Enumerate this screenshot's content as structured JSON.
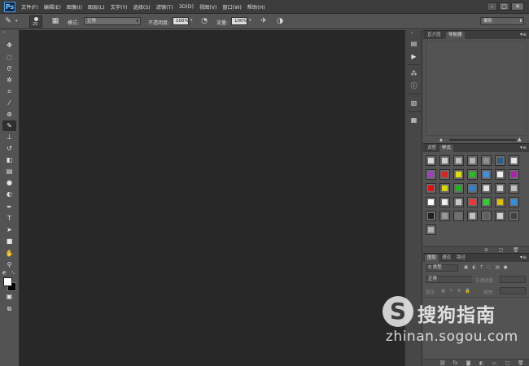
{
  "app": {
    "logo": "Ps"
  },
  "menu": [
    "文件(F)",
    "编辑(E)",
    "图像(I)",
    "图层(L)",
    "文字(Y)",
    "选择(S)",
    "滤镜(T)",
    "3D(D)",
    "视图(V)",
    "窗口(W)",
    "帮助(H)"
  ],
  "window_controls": {
    "minimize": "–",
    "maximize": "□",
    "close": "✕"
  },
  "options": {
    "brush_size": "25",
    "mode_label": "模式:",
    "mode_value": "正常",
    "opacity_label": "不透明度:",
    "opacity_value": "100%",
    "flow_label": "流量:",
    "flow_value": "100%",
    "workspace": "摄影"
  },
  "panels": {
    "navigator": {
      "tabs": [
        "直方图",
        "导航器"
      ]
    },
    "styles": {
      "tabs": [
        "调整",
        "样式"
      ]
    },
    "layers": {
      "tabs": [
        "图层",
        "通道",
        "路径"
      ],
      "filter_kind": "类型",
      "blend_mode": "正常",
      "opacity_label": "不透明度:",
      "lock_label": "锁定:",
      "fill_label": "填充:"
    }
  },
  "colors": {
    "swatches": [
      "#d8d8d8",
      "#cfcfcf",
      "#bdbdbd",
      "#b4b4b4",
      "#8f8f8f",
      "#2e5c8a",
      "#e8e8e8",
      "#a040c0",
      "#e02020",
      "#e0e000",
      "#20c020",
      "#4090e0",
      "#f0f0f0",
      "#b020b0",
      "#e01010",
      "#d8d800",
      "#20b020",
      "#3080d0",
      "#e0e0e0",
      "#d0d0d0",
      "#c0c0c0",
      "#ffffff",
      "#f0f0f0",
      "#c8c8c8",
      "#ff3030",
      "#30d030",
      "#e0c000",
      "#3090e0",
      "#202020",
      "#9a9a9a",
      "#707070",
      "#c0c0c0",
      "#606060",
      "#d0d0d0",
      "#404040",
      "#b0b0b0"
    ]
  },
  "watermark": {
    "icon": "S",
    "title": "搜狗指南",
    "url": "zhinan.sogou.com"
  }
}
